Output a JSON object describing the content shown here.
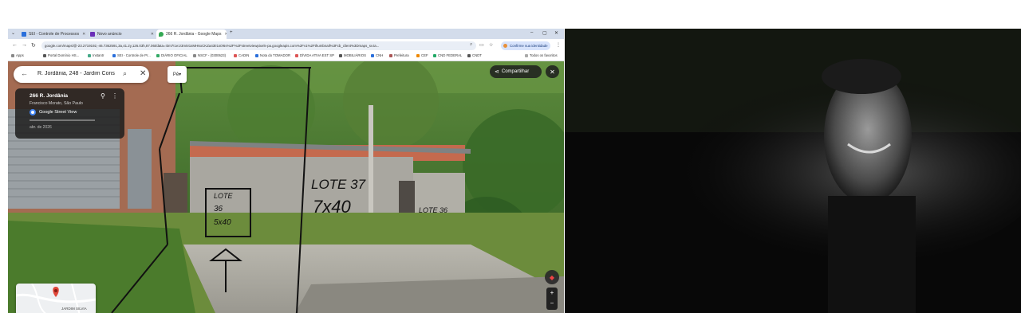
{
  "browser": {
    "tabs": [
      {
        "label": "SEI - Controle de Processos",
        "color": "#2a6fdb"
      },
      {
        "label": "Novo anúncio",
        "color": "#6a2fb8"
      },
      {
        "label": "266 R. Jordânia - Google Maps",
        "color": "#34a853",
        "active": true
      }
    ],
    "new_tab": "+",
    "window_controls": {
      "menu": "⌄",
      "minimize": "–",
      "maximize": "▢",
      "close": "✕"
    },
    "url": "google.com/maps/@-23.2719192,-46.7362591,3a,41.2y,126.03h,87.06t/data=!3m7!1e1!3m5!1sMH6oCKZa43t!1s0!6s%2F%2Fstreetviewpixels-pa.googleapis.com%2Fv1%2Fthumbnail%3Fcb_client%3Dmaps_sv.ta...",
    "confirm_identity": "Confirme sua identidade",
    "bookmarks": [
      "Apps",
      "Portal Domínio HS...",
      "Instantr",
      "SEI - Controle de Pr...",
      "DIÁRIO OFICIAL",
      "NSCF - (0300623)",
      "CADIN",
      "Nota do TOMADOR",
      "DÍVIDA ATIVA EST SP",
      "MOBILIÁRIOS",
      "CNH",
      "Prefeitura",
      "CEF",
      "CND FEDERAL",
      "CNDT"
    ],
    "all_favorites": "Todos os favoritos"
  },
  "streetview": {
    "search_value": "R. Jordânia, 248 - Jardim Cons",
    "dropdown": "Pê",
    "info": {
      "address": "266 R. Jordânia",
      "city": "Francisco Morato, São Paulo",
      "provider": "Google Street View",
      "date": "abr. de 2026"
    },
    "share_label": "Compartilhar",
    "close": "✕",
    "zoom_in": "+",
    "zoom_out": "−",
    "minimap_label": "JARDIM SILVIA"
  },
  "annotations": {
    "left_box": [
      "LOTE",
      "36",
      "5x40"
    ],
    "right_lote": "LOTE 37",
    "right_size": "7x40",
    "wall_text": "LOTE 36"
  },
  "colors": {
    "tab_strip": "#d3dceb",
    "vegetation": "#3f6a2c",
    "wall": "#a9a7a0",
    "video_bg": "#080808"
  }
}
